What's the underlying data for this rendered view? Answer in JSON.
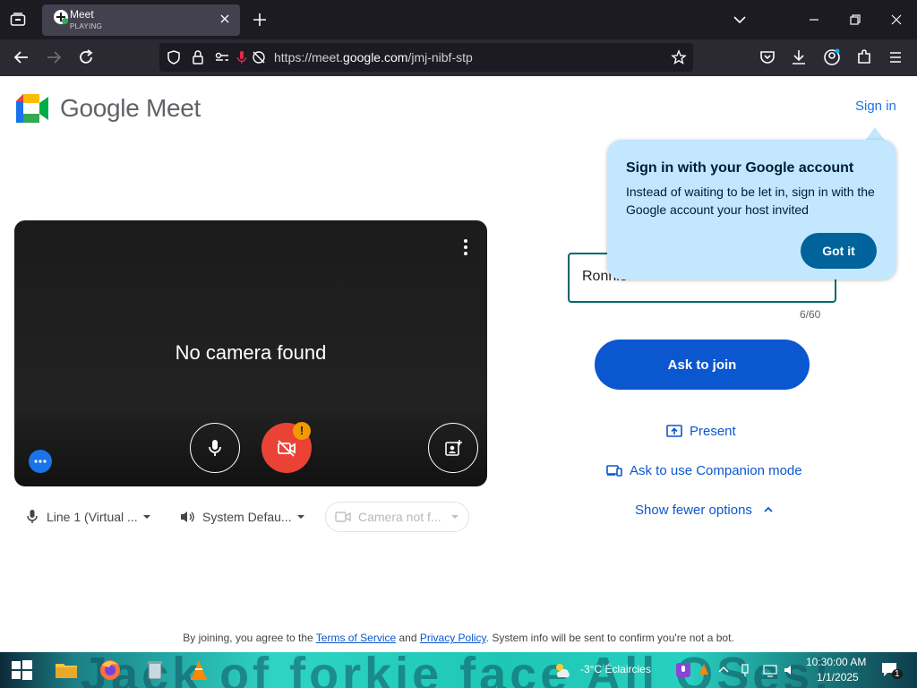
{
  "browser": {
    "tab": {
      "title": "Meet",
      "status": "PLAYING"
    },
    "url": {
      "prefix": "https://meet.",
      "host": "google.com",
      "path": "/jmj-nibf-stp"
    }
  },
  "header": {
    "brand": "Google Meet",
    "signin_label": "Sign in"
  },
  "preview": {
    "message": "No camera found",
    "warning_badge": "!"
  },
  "devices": {
    "microphone": "Line 1 (Virtual ...",
    "speaker": "System Defau...",
    "camera": "Camera not f..."
  },
  "join": {
    "name_value": "Ronnie",
    "char_count": "6/60",
    "ask_button": "Ask to join",
    "present_label": "Present",
    "companion_label": "Ask to use Companion mode",
    "fewer_options_label": "Show fewer options"
  },
  "tooltip": {
    "title": "Sign in with your Google account",
    "body": "Instead of waiting to be let in, sign in with the Google account your host invited",
    "button": "Got it"
  },
  "legal": {
    "prefix": "By joining, you agree to the ",
    "terms": "Terms of Service",
    "and": " and ",
    "privacy": "Privacy Policy",
    "suffix": ". System info will be sent to confirm you're not a bot."
  },
  "taskbar": {
    "wallpaper_text": "Jack of forkie face All OSes!",
    "weather": "-3°C  Éclaircies",
    "time": "10:30:00 AM",
    "date": "1/1/2025",
    "notification_count": "1"
  },
  "colors": {
    "accent": "#0b57d0",
    "tooltip_bg": "#c2e7ff",
    "camera_off": "#ea4335",
    "field_border": "#00686a"
  }
}
